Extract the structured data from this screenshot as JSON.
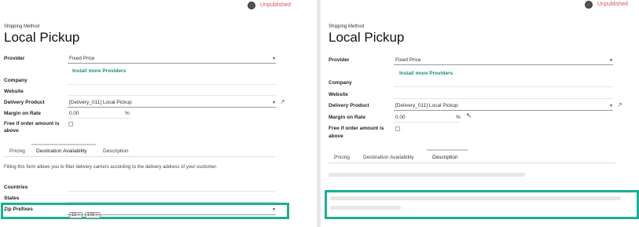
{
  "left": {
    "status": "Unpublished",
    "form_label": "Shipping Method",
    "title": "Local Pickup",
    "fields": {
      "provider_label": "Provider",
      "provider_value": "Fixed Price",
      "install_link": "Install more Providers",
      "company_label": "Company",
      "website_label": "Website",
      "delivery_product_label": "Delivery Product",
      "delivery_product_value": "[Delivery_011] Local Pickup",
      "margin_label": "Margin on Rate",
      "margin_value": "0.00",
      "margin_unit": "%",
      "free_label_1": "Free if order amount is",
      "free_label_2": "above"
    },
    "tabs": [
      "Pricing",
      "Destination Availability",
      "Description"
    ],
    "active_tab": "Destination Availability",
    "help_text": "Filling this form allows you to filter delivery carriers according to the delivery address of your customer.",
    "countries_label": "Countries",
    "states_label": "States",
    "zip_label": "Zip Prefixes",
    "zip_tags": [
      "13 ×",
      "143 ×"
    ]
  },
  "right": {
    "status": "Unpublished",
    "form_label": "Shipping Method",
    "title": "Local Pickup",
    "fields": {
      "provider_label": "Provider",
      "provider_value": "Fixed Price",
      "install_link": "Install more Providers",
      "company_label": "Company",
      "website_label": "Website",
      "delivery_product_label": "Delivery Product",
      "delivery_product_value": "[Delivery_011] Local Pickup",
      "margin_label": "Margin on Rate",
      "margin_value": "0.00",
      "margin_unit": "%",
      "free_label_1": "Free if order amount is",
      "free_label_2": "above"
    },
    "tabs": [
      "Pricing",
      "Destination Availability",
      "Description"
    ],
    "active_tab": "Description"
  },
  "colors": {
    "highlight": "#19b095",
    "link": "#1b8a7a",
    "status": "#d9534f"
  }
}
